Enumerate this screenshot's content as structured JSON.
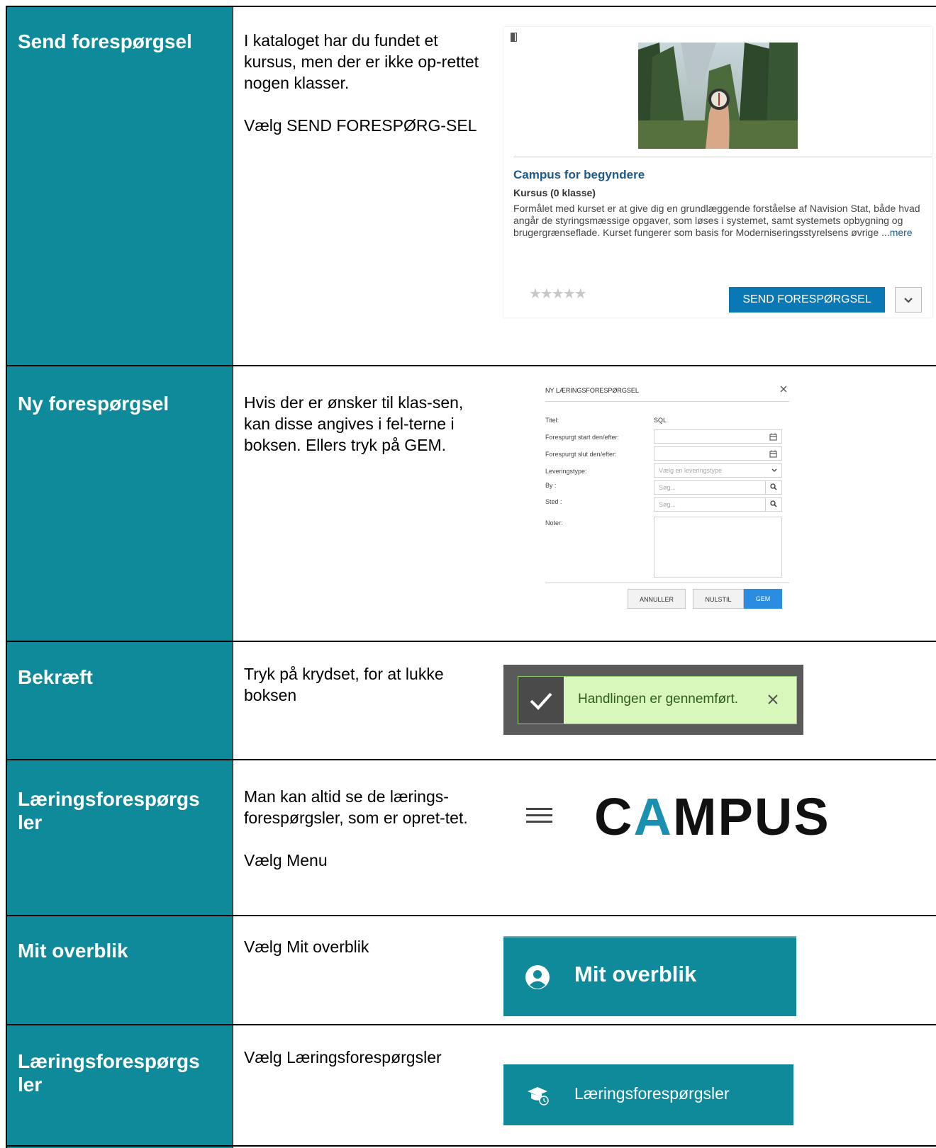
{
  "rows": [
    {
      "title": "Send forespørgsel",
      "text": "I kataloget har du fundet et kursus, men der er ikke op-rettet nogen klasser.\n\nVælg SEND FORESPØRG-SEL"
    },
    {
      "title": "Ny forespørgsel",
      "text": "Hvis der er ønsker til klas-sen, kan disse angives i fel-terne i boksen. Ellers tryk på GEM."
    },
    {
      "title": "Bekræft",
      "text": "Tryk på krydset, for at lukke boksen"
    },
    {
      "title": "Læringsforespørgs ler",
      "text": "Man kan altid se de lærings-forespørgsler, som er opret-tet.\n\nVælg Menu"
    },
    {
      "title": "Mit overblik",
      "text": "Vælg Mit overblik"
    },
    {
      "title": "Læringsforespørgs ler",
      "text": "Vælg Læringsforespørgsler"
    }
  ],
  "course_card": {
    "title": "Campus for begyndere",
    "subtitle": "Kursus (0 klasse)",
    "description": "Formålet med kurset er at give dig en grundlæggende forståelse af Navision Stat, både hvad angår de styringsmæssige opgaver, som løses i systemet, samt systemets opbygning og brugergrænseflade. Kurset fungerer som basis for Moderniseringsstyrelsens øvrige ...",
    "more_link": "mere",
    "stars": "★★★★★",
    "rating": 0,
    "send_button": "SEND FORESPØRGSEL",
    "accent": "#0a78b4"
  },
  "dialog": {
    "title": "NY LÆRINGSFORESPØRGSEL",
    "fields": {
      "titel_label": "Titel:",
      "titel_value": "SQL",
      "start_label": "Forespurgt start den/efter:",
      "slut_label": "Forespurgt slut den/efter:",
      "levering_label": "Leveringstype:",
      "levering_placeholder": "Vælg en leveringstype",
      "by_label": "By :",
      "by_placeholder": "Søg...",
      "sted_label": "Sted :",
      "sted_placeholder": "Søg...",
      "noter_label": "Noter:"
    },
    "buttons": {
      "cancel": "ANNULLER",
      "reset": "NULSTIL",
      "save": "GEM"
    }
  },
  "toast": {
    "message": "Handlingen er gennemført."
  },
  "header": {
    "logo_pre": "C",
    "logo_a": "A",
    "logo_post": "MPUS"
  },
  "menu": {
    "mit_overblik": "Mit overblik",
    "laeringsforespoergsler": "Læringsforespørgsler"
  },
  "colors": {
    "teal": "#0e8a9a",
    "toast_bg": "#d8f8bb"
  }
}
